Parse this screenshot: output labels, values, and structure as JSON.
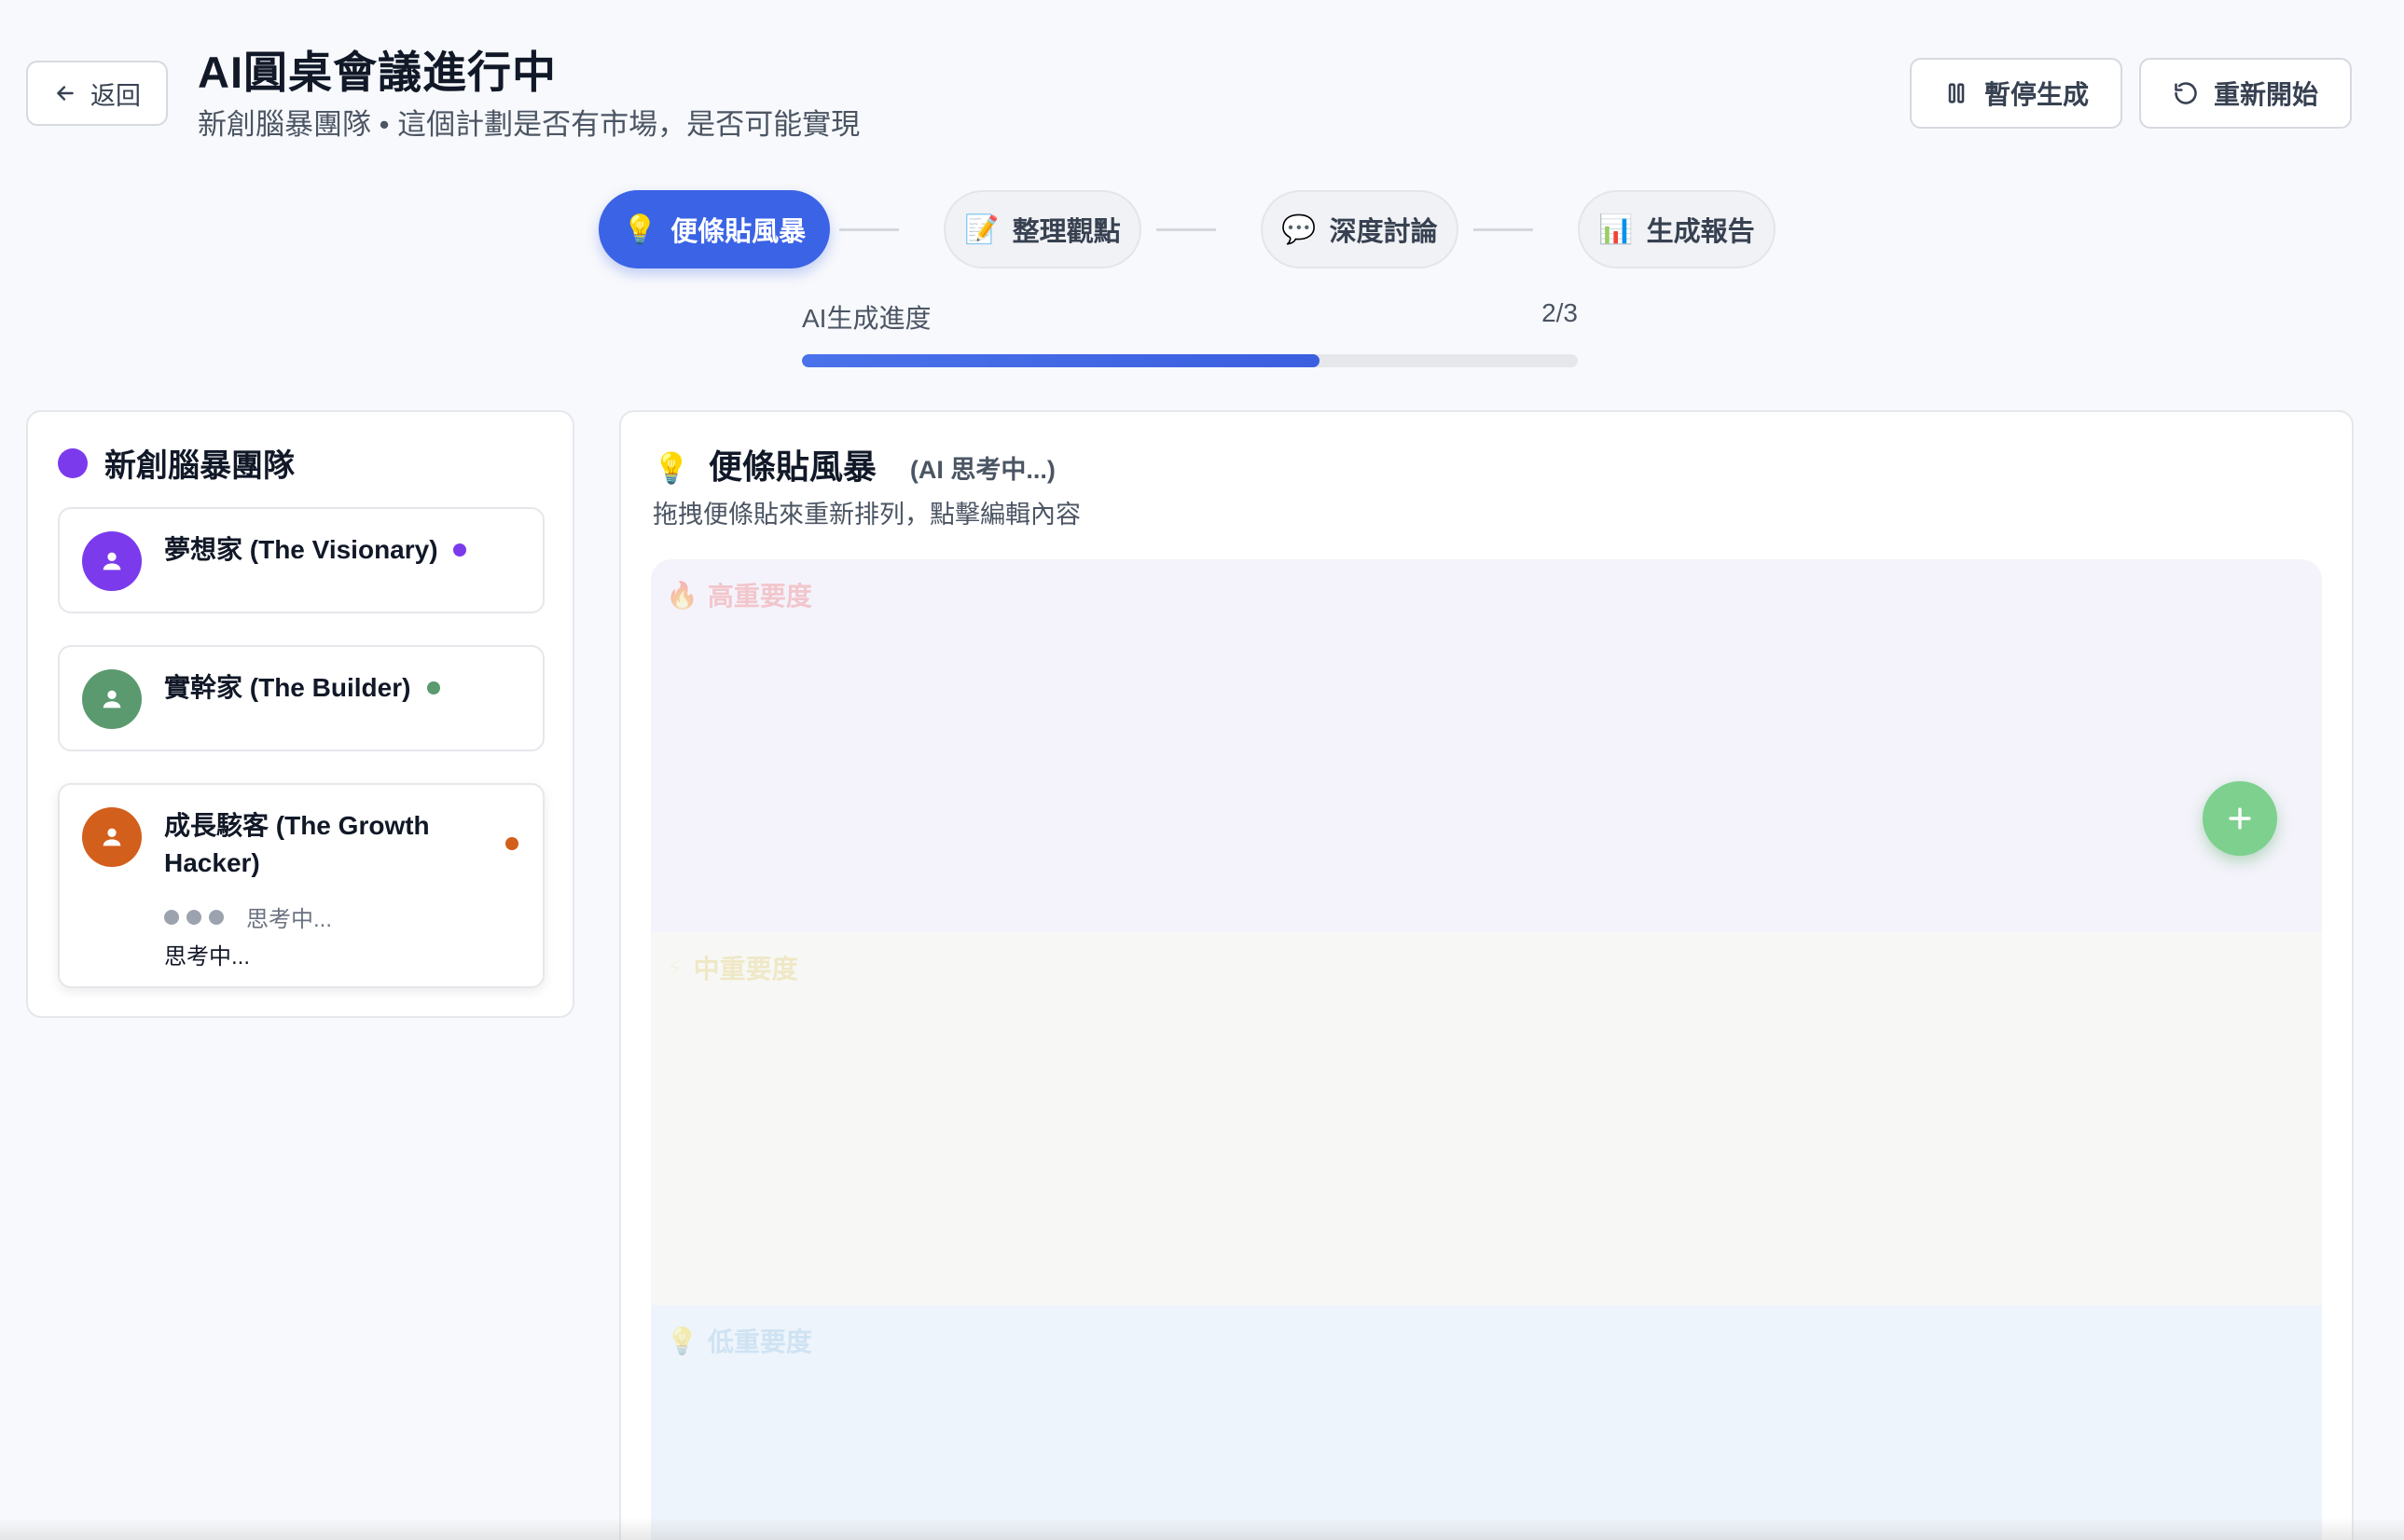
{
  "header": {
    "back_label": "返回",
    "title": "AI圓桌會議進行中",
    "subtitle": "新創腦暴團隊 • 這個計劃是否有市場，是否可能實現",
    "pause_label": "暫停生成",
    "restart_label": "重新開始"
  },
  "steps": [
    {
      "label": "便條貼風暴",
      "icon": "lightbulb-icon",
      "active": true
    },
    {
      "label": "整理觀點",
      "icon": "memo-icon",
      "active": false
    },
    {
      "label": "深度討論",
      "icon": "speech-bubble-icon",
      "active": false
    },
    {
      "label": "生成報告",
      "icon": "bar-chart-icon",
      "active": false
    }
  ],
  "progress": {
    "label": "AI生成進度",
    "count_text": "2/3",
    "fraction": 0.667
  },
  "team": {
    "name": "新創腦暴團隊",
    "color": "#7c3aed",
    "members": [
      {
        "name": "夢想家 (The Visionary)",
        "color": "#7c3aed"
      },
      {
        "name": "實幹家 (The Builder)",
        "color": "#5a9a6e"
      },
      {
        "name": "成長駭客 (The Growth Hacker)",
        "color": "#d35f1c",
        "typing_label": "思考中...",
        "message": "思考中..."
      }
    ]
  },
  "board": {
    "title": "便條貼風暴",
    "status": "(AI 思考中...)",
    "hint": "拖拽便條貼來重新排列，點擊編輯內容",
    "zones": {
      "high": "高重要度",
      "mid": "中重要度",
      "low": "低重要度"
    }
  },
  "colors": {
    "accent": "#3b63e6",
    "fab": "#7ed08e"
  }
}
